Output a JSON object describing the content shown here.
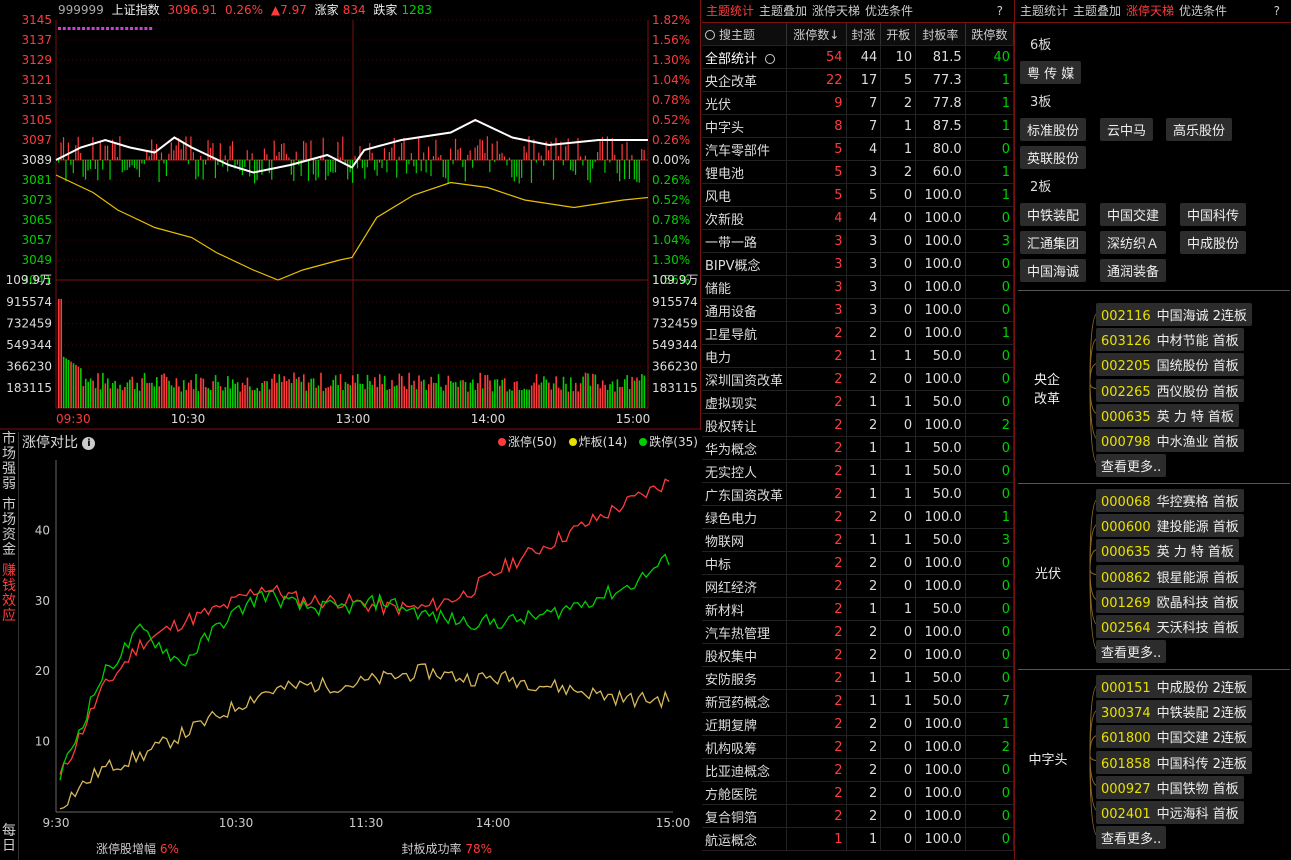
{
  "intraday": {
    "code": "999999",
    "name": "上证指数",
    "price": "3096.91",
    "pct": "0.26%",
    "change": "▲7.97",
    "up_label": "涨家",
    "up_count": "834",
    "down_label": "跌家",
    "down_count": "1283",
    "price_ticks": [
      "3145",
      "3137",
      "3129",
      "3121",
      "3113",
      "3105",
      "3097",
      "3089",
      "3081",
      "3073",
      "3065",
      "3057",
      "3049",
      "3041"
    ],
    "pct_ticks": [
      "1.82%",
      "1.56%",
      "1.30%",
      "1.04%",
      "0.78%",
      "0.52%",
      "0.26%",
      "0.00%",
      "0.26%",
      "0.52%",
      "0.78%",
      "1.04%",
      "1.30%",
      "1.56%"
    ],
    "vol_unit": "109.9万",
    "vol_ticks": [
      "915574",
      "732459",
      "549344",
      "366230",
      "183115"
    ],
    "time_ticks": [
      "09:30",
      "10:30",
      "13:00",
      "14:00",
      "15:00"
    ],
    "colors": {
      "up": "#ff3b3b",
      "down": "#00d000",
      "line_white": "#ffffff",
      "line_yellow": "#e8c000"
    }
  },
  "side_tabs": [
    {
      "label": "市场强弱",
      "active": false
    },
    {
      "label": "市场资金",
      "active": false
    },
    {
      "label": "赚钱效应",
      "active": true
    },
    {
      "label": "每日",
      "active": false
    }
  ],
  "compare": {
    "title": "涨停对比",
    "legend": [
      {
        "label": "涨停(50)",
        "color": "#ff3b3b"
      },
      {
        "label": "炸板(14)",
        "color": "#e8e000"
      },
      {
        "label": "跌停(35)",
        "color": "#00d000"
      }
    ],
    "stat1_label": "涨停股增幅",
    "stat1_value": "6%",
    "stat2_label": "封板成功率",
    "stat2_value": "78%"
  },
  "chart_data": {
    "type": "line",
    "x": [
      "9:30",
      "10:30",
      "11:30",
      "14:00",
      "15:00"
    ],
    "ylim": [
      0,
      50
    ],
    "yticks": [
      "10",
      "20",
      "30",
      "40"
    ],
    "series": [
      {
        "name": "涨停(50)",
        "color": "#ff3b3b",
        "values": [
          5,
          17,
          24,
          27,
          29,
          32,
          30,
          30,
          29,
          29,
          31,
          35,
          38,
          41,
          44,
          47
        ]
      },
      {
        "name": "炸板(14)",
        "color": "#d8b85a",
        "values": [
          1,
          6,
          8,
          11,
          14,
          17,
          18,
          18,
          19,
          20,
          19,
          19,
          18,
          17,
          16,
          16
        ]
      },
      {
        "name": "跌停(35)",
        "color": "#00d000",
        "values": [
          5,
          19,
          26,
          21,
          27,
          31,
          29,
          29,
          30,
          28,
          27,
          27,
          28,
          30,
          32,
          36
        ]
      }
    ]
  },
  "theme_panel": {
    "tabs": [
      {
        "label": "主题统计",
        "active": true
      },
      {
        "label": "主题叠加",
        "active": false
      },
      {
        "label": "涨停天梯",
        "active": false
      },
      {
        "label": "优选条件",
        "active": false
      }
    ],
    "help": "?",
    "search": "搜主题",
    "headers": [
      "涨停数↓",
      "封涨",
      "开板",
      "封板率",
      "跌停数"
    ],
    "rows": [
      [
        "全部统计",
        "54",
        "44",
        "10",
        "81.5",
        "40"
      ],
      [
        "央企改革",
        "22",
        "17",
        "5",
        "77.3",
        "1"
      ],
      [
        "光伏",
        "9",
        "7",
        "2",
        "77.8",
        "1"
      ],
      [
        "中字头",
        "8",
        "7",
        "1",
        "87.5",
        "1"
      ],
      [
        "汽车零部件",
        "5",
        "4",
        "1",
        "80.0",
        "0"
      ],
      [
        "锂电池",
        "5",
        "3",
        "2",
        "60.0",
        "1"
      ],
      [
        "风电",
        "5",
        "5",
        "0",
        "100.0",
        "1"
      ],
      [
        "次新股",
        "4",
        "4",
        "0",
        "100.0",
        "0"
      ],
      [
        "一带一路",
        "3",
        "3",
        "0",
        "100.0",
        "3"
      ],
      [
        "BIPV概念",
        "3",
        "3",
        "0",
        "100.0",
        "0"
      ],
      [
        "储能",
        "3",
        "3",
        "0",
        "100.0",
        "0"
      ],
      [
        "通用设备",
        "3",
        "3",
        "0",
        "100.0",
        "0"
      ],
      [
        "卫星导航",
        "2",
        "2",
        "0",
        "100.0",
        "1"
      ],
      [
        "电力",
        "2",
        "1",
        "1",
        "50.0",
        "0"
      ],
      [
        "深圳国资改革",
        "2",
        "2",
        "0",
        "100.0",
        "0"
      ],
      [
        "虚拟现实",
        "2",
        "1",
        "1",
        "50.0",
        "0"
      ],
      [
        "股权转让",
        "2",
        "2",
        "0",
        "100.0",
        "2"
      ],
      [
        "华为概念",
        "2",
        "1",
        "1",
        "50.0",
        "0"
      ],
      [
        "无实控人",
        "2",
        "1",
        "1",
        "50.0",
        "0"
      ],
      [
        "广东国资改革",
        "2",
        "1",
        "1",
        "50.0",
        "0"
      ],
      [
        "绿色电力",
        "2",
        "2",
        "0",
        "100.0",
        "1"
      ],
      [
        "物联网",
        "2",
        "1",
        "1",
        "50.0",
        "3"
      ],
      [
        "中标",
        "2",
        "2",
        "0",
        "100.0",
        "0"
      ],
      [
        "网红经济",
        "2",
        "2",
        "0",
        "100.0",
        "0"
      ],
      [
        "新材料",
        "2",
        "1",
        "1",
        "50.0",
        "0"
      ],
      [
        "汽车热管理",
        "2",
        "2",
        "0",
        "100.0",
        "0"
      ],
      [
        "股权集中",
        "2",
        "2",
        "0",
        "100.0",
        "0"
      ],
      [
        "安防服务",
        "2",
        "1",
        "1",
        "50.0",
        "0"
      ],
      [
        "新冠药概念",
        "2",
        "1",
        "1",
        "50.0",
        "7"
      ],
      [
        "近期复牌",
        "2",
        "2",
        "0",
        "100.0",
        "1"
      ],
      [
        "机构吸筹",
        "2",
        "2",
        "0",
        "100.0",
        "2"
      ],
      [
        "比亚迪概念",
        "2",
        "2",
        "0",
        "100.0",
        "0"
      ],
      [
        "方舱医院",
        "2",
        "2",
        "0",
        "100.0",
        "0"
      ],
      [
        "复合铜箔",
        "2",
        "2",
        "0",
        "100.0",
        "0"
      ],
      [
        "航运概念",
        "1",
        "1",
        "0",
        "100.0",
        "0"
      ]
    ]
  },
  "ladder_panel": {
    "tabs": [
      {
        "label": "主题统计",
        "active": false
      },
      {
        "label": "主题叠加",
        "active": false
      },
      {
        "label": "涨停天梯",
        "active": true
      },
      {
        "label": "优选条件",
        "active": false
      }
    ],
    "help": "?",
    "levels": [
      {
        "label": "6板",
        "stocks": [
          "粤 传 媒"
        ]
      },
      {
        "label": "3板",
        "stocks": [
          "标准股份",
          "云中马",
          "高乐股份",
          "英联股份"
        ]
      },
      {
        "label": "2板",
        "stocks": [
          "中铁装配",
          "中国交建",
          "中国科传",
          "汇通集团",
          "深纺织Ａ",
          "中成股份",
          "中国海诚",
          "通润装备"
        ]
      }
    ],
    "groups": [
      {
        "name": "央企改革",
        "items": [
          [
            "002116",
            "中国海诚",
            "2连板"
          ],
          [
            "603126",
            "中材节能",
            "首板"
          ],
          [
            "002205",
            "国统股份",
            "首板"
          ],
          [
            "002265",
            "西仪股份",
            "首板"
          ],
          [
            "000635",
            "英 力 特",
            "首板"
          ],
          [
            "000798",
            "中水渔业",
            "首板"
          ]
        ]
      },
      {
        "name": "光伏",
        "items": [
          [
            "000068",
            "华控赛格",
            "首板"
          ],
          [
            "000600",
            "建投能源",
            "首板"
          ],
          [
            "000635",
            "英 力 特",
            "首板"
          ],
          [
            "000862",
            "银星能源",
            "首板"
          ],
          [
            "001269",
            "欧晶科技",
            "首板"
          ],
          [
            "002564",
            "天沃科技",
            "首板"
          ]
        ]
      },
      {
        "name": "中字头",
        "items": [
          [
            "000151",
            "中成股份",
            "2连板"
          ],
          [
            "300374",
            "中铁装配",
            "2连板"
          ],
          [
            "601800",
            "中国交建",
            "2连板"
          ],
          [
            "601858",
            "中国科传",
            "2连板"
          ],
          [
            "000927",
            "中国铁物",
            "首板"
          ],
          [
            "002401",
            "中远海科",
            "首板"
          ]
        ]
      }
    ],
    "more_label": "查看更多.."
  }
}
